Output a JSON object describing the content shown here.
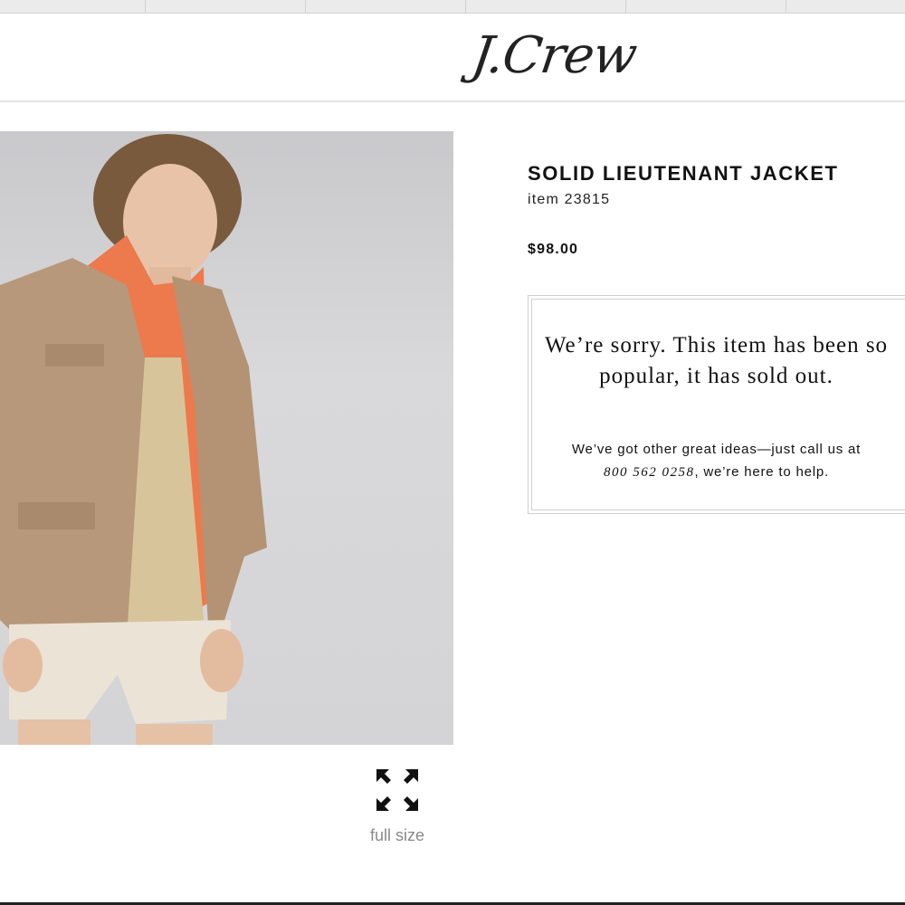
{
  "header": {
    "logo_text": "J.Crew"
  },
  "product": {
    "title": "SOLID LIEUTENANT JACKET",
    "item_number": "item 23815",
    "price": "$98.00",
    "photo_icon": "product-photo"
  },
  "soldout": {
    "message": "We’re sorry. This item has been so popular, it has sold out.",
    "help_prefix": "We’ve got other great ideas—just call us at",
    "phone": "800 562 0258",
    "help_suffix": ", we’re here to help."
  },
  "viewer": {
    "expand_icon": "expand-arrows-icon",
    "full_size_label": "full size"
  }
}
